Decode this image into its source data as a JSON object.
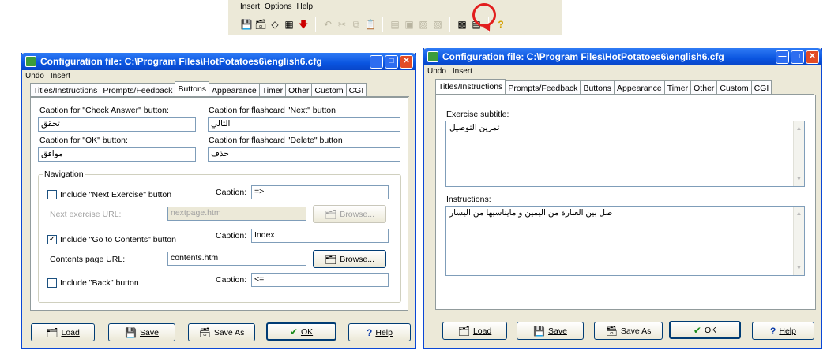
{
  "toolbar": {
    "menu": [
      "Insert",
      "Options",
      "Help"
    ]
  },
  "left_window": {
    "title": "Configuration file: C:\\Program Files\\HotPotatoes6\\english6.cfg",
    "menu": [
      "Undo",
      "Insert"
    ],
    "tabs": [
      "Titles/Instructions",
      "Prompts/Feedback",
      "Buttons",
      "Appearance",
      "Timer",
      "Other",
      "Custom",
      "CGI"
    ],
    "active_tab": "Buttons",
    "check_answer_label": "Caption for \"Check Answer\" button:",
    "check_answer_value": "تحقق",
    "next_label": "Caption for flashcard \"Next\" button",
    "next_value": "التالي",
    "ok_label": "Caption for \"OK\" button:",
    "ok_value": "موافق",
    "delete_label": "Caption for flashcard \"Delete\" button",
    "delete_value": "حذف",
    "navigation": {
      "title": "Navigation",
      "next_exercise_label": "Include \"Next Exercise\" button",
      "next_exercise_checked": false,
      "caption_label": "Caption:",
      "next_caption": "=>",
      "next_url_label": "Next exercise URL:",
      "next_url": "nextpage.htm",
      "browse": "Browse...",
      "contents_label": "Include \"Go to Contents\" button",
      "contents_checked": true,
      "contents_caption": "Index",
      "contents_url_label": "Contents page URL:",
      "contents_url": "contents.htm",
      "back_label": "Include \"Back\" button",
      "back_checked": false,
      "back_caption": "<="
    }
  },
  "right_window": {
    "title": "Configuration file: C:\\Program Files\\HotPotatoes6\\english6.cfg",
    "menu": [
      "Undo",
      "Insert"
    ],
    "tabs": [
      "Titles/Instructions",
      "Prompts/Feedback",
      "Buttons",
      "Appearance",
      "Timer",
      "Other",
      "Custom",
      "CGI"
    ],
    "active_tab": "Titles/Instructions",
    "subtitle_label": "Exercise subtitle:",
    "subtitle_value": "تمرين التوصيل",
    "instructions_label": "Instructions:",
    "instructions_value": "صل بين العبارة من اليمين و  مايناسبها من اليسار"
  },
  "buttons": {
    "load": "Load",
    "save": "Save",
    "save_as": "Save As",
    "ok": "OK",
    "help": "Help"
  },
  "colors": {
    "title_bar": "#0a55e0",
    "window_bg": "#ece9d8",
    "highlight_circle": "#e21e1e"
  }
}
